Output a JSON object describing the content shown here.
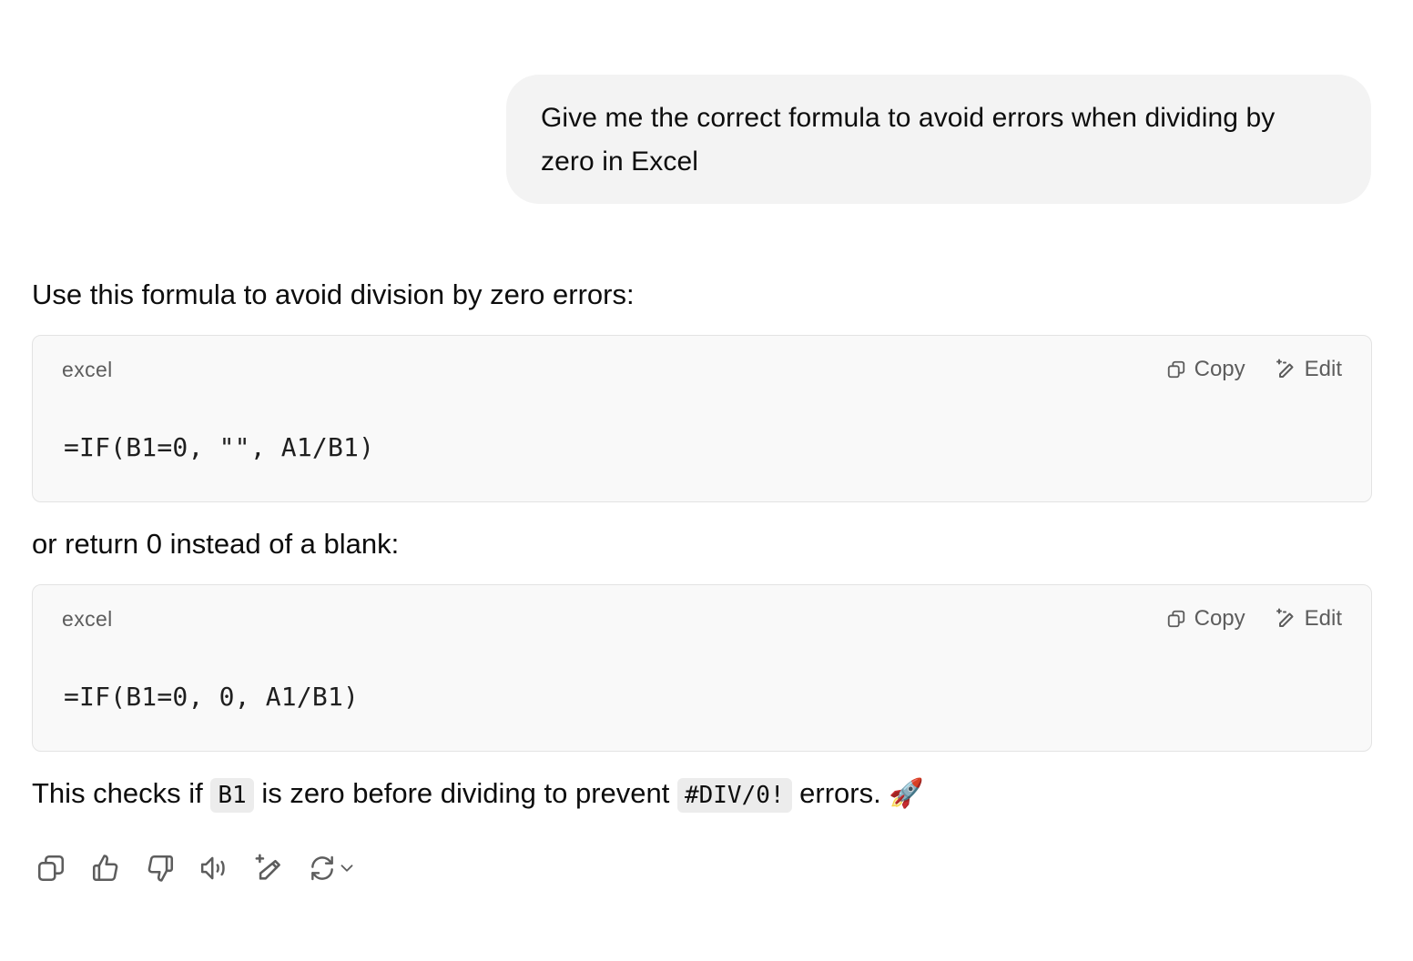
{
  "user_message": {
    "text": "Give me the correct formula to avoid errors when dividing by zero in Excel"
  },
  "assistant": {
    "intro": "Use this formula to avoid division by zero errors:",
    "code_blocks": [
      {
        "language": "excel",
        "copy_label": "Copy",
        "edit_label": "Edit",
        "code": "=IF(B1=0, \"\", A1/B1)"
      },
      {
        "language": "excel",
        "copy_label": "Copy",
        "edit_label": "Edit",
        "code": "=IF(B1=0, 0, A1/B1)"
      }
    ],
    "middle": "or return 0 instead of a blank:",
    "outro": {
      "part1": "This checks if ",
      "code1": "B1",
      "part2": " is zero before dividing to prevent ",
      "code2": "#DIV/0!",
      "part3": " errors. ",
      "emoji": "🚀"
    }
  },
  "message_actions": [
    {
      "name": "copy-message-icon"
    },
    {
      "name": "thumbs-up-icon"
    },
    {
      "name": "thumbs-down-icon"
    },
    {
      "name": "read-aloud-icon"
    },
    {
      "name": "edit-canvas-icon"
    },
    {
      "name": "regenerate-icon"
    }
  ]
}
